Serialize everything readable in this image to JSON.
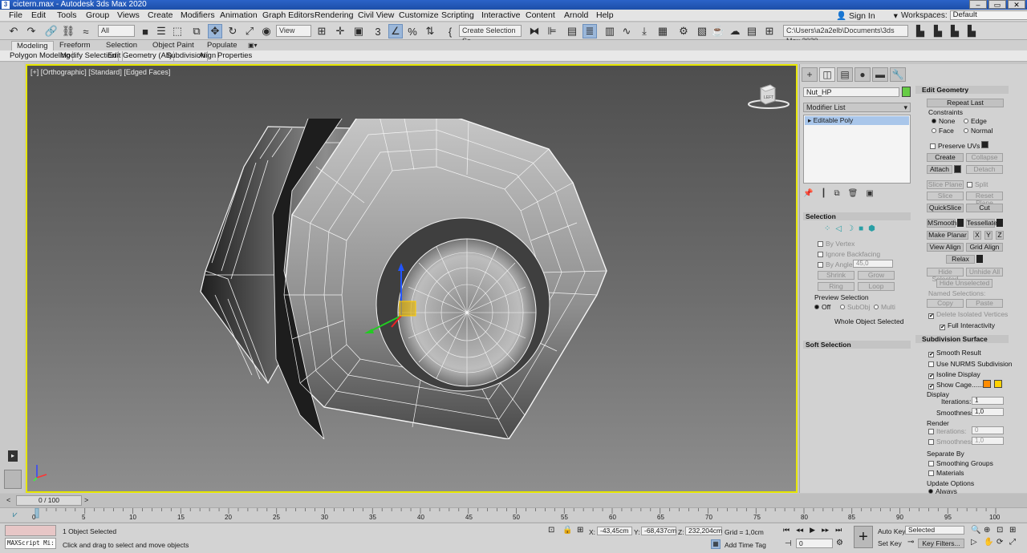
{
  "window": {
    "title": "cictern.max - Autodesk 3ds Max 2020",
    "app_icon": "3"
  },
  "menu": [
    "File",
    "Edit",
    "Tools",
    "Group",
    "Views",
    "Create",
    "Modifiers",
    "Animation",
    "Graph Editors",
    "Rendering",
    "Civil View",
    "Customize",
    "Scripting",
    "Interactive",
    "Content",
    "Arnold",
    "Help"
  ],
  "account": {
    "signin": "Sign In",
    "workspaces_label": "Workspaces:",
    "workspaces_value": "Default"
  },
  "toolbar": {
    "filter": "All",
    "ref_coord": "View",
    "selection_set": "Create Selection Se",
    "project_path": "C:\\Users\\a2a2elb\\Documents\\3ds Max 2020"
  },
  "ribbon": {
    "tabs": [
      "Modeling",
      "Freeform",
      "Selection",
      "Object Paint",
      "Populate"
    ],
    "panels": [
      "Polygon Modeling",
      "Modify Selection",
      "Edit",
      "Geometry (All)",
      "Subdivision",
      "Align",
      "Properties"
    ]
  },
  "viewport": {
    "label": "[+] [Orthographic] [Standard] [Edged Faces]",
    "viewcube_label": "LEFT",
    "accent_color": "#e6e600"
  },
  "command_panel": {
    "object_name": "Nut_HP",
    "object_color": "#66cc44",
    "modifier_list": "Modifier List",
    "stack_item": "Editable Poly",
    "selection": {
      "title": "Selection",
      "by_vertex": "By Vertex",
      "ignore_backfacing": "Ignore Backfacing",
      "by_angle": "By Angle:",
      "angle_value": "45,0",
      "shrink": "Shrink",
      "grow": "Grow",
      "ring": "Ring",
      "loop": "Loop",
      "preview_selection": "Preview Selection",
      "off": "Off",
      "subobj": "SubObj",
      "multi": "Multi",
      "whole_object": "Whole Object Selected"
    },
    "soft_selection": "Soft Selection",
    "edit_geometry": {
      "title": "Edit Geometry",
      "repeat_last": "Repeat Last",
      "constraints": "Constraints",
      "none": "None",
      "edge": "Edge",
      "face": "Face",
      "normal": "Normal",
      "preserve_uvs": "Preserve UVs",
      "create": "Create",
      "collapse": "Collapse",
      "attach": "Attach",
      "detach": "Detach",
      "slice_plane": "Slice Plane",
      "split": "Split",
      "slice": "Slice",
      "reset_plane": "Reset Plane",
      "quickslice": "QuickSlice",
      "cut": "Cut",
      "msmooth": "MSmooth",
      "tessellate": "Tessellate",
      "make_planar": "Make Planar",
      "x": "X",
      "y": "Y",
      "z": "Z",
      "view_align": "View Align",
      "grid_align": "Grid Align",
      "relax": "Relax",
      "hide_selected": "Hide Selected",
      "unhide_all": "Unhide All",
      "hide_unselected": "Hide Unselected",
      "named_selections": "Named Selections:",
      "copy": "Copy",
      "paste": "Paste",
      "delete_isolated": "Delete Isolated Vertices",
      "full_interactivity": "Full Interactivity"
    },
    "subdivision_surface": {
      "title": "Subdivision Surface",
      "smooth_result": "Smooth Result",
      "use_nurms": "Use NURMS Subdivision",
      "isoline_display": "Isoline Display",
      "show_cage": "Show Cage......",
      "cage_color_1": "#ff8c00",
      "cage_color_2": "#ffd200",
      "display": "Display",
      "iterations_label": "Iterations:",
      "iterations_value": "1",
      "smoothness_label": "Smoothness:",
      "smoothness_value": "1,0",
      "render": "Render",
      "render_iterations": "0",
      "render_smoothness": "1,0",
      "separate_by": "Separate By",
      "smoothing_groups": "Smoothing Groups",
      "materials": "Materials",
      "update_options": "Update Options",
      "always": "Always"
    }
  },
  "timeline": {
    "frame_counter": "0 / 100",
    "ticks": [
      "0",
      "5",
      "10",
      "15",
      "20",
      "25",
      "30",
      "35",
      "40",
      "45",
      "50",
      "55",
      "60",
      "65",
      "70",
      "75",
      "80",
      "85",
      "90",
      "95",
      "100"
    ]
  },
  "status": {
    "maxscript": "MAXScript Mi:",
    "selected": "1 Object Selected",
    "prompt": "Click and drag to select and move objects",
    "x_label": "X:",
    "x": "-43,45cm",
    "y_label": "Y:",
    "y": "-68,437cm",
    "z_label": "Z:",
    "z": "232,204cm",
    "grid": "Grid = 1,0cm",
    "add_time_tag": "Add Time Tag",
    "auto_key": "Auto Key",
    "set_key": "Set Key",
    "key_mode": "Selected",
    "key_filters": "Key Filters...",
    "current_frame": "0"
  }
}
